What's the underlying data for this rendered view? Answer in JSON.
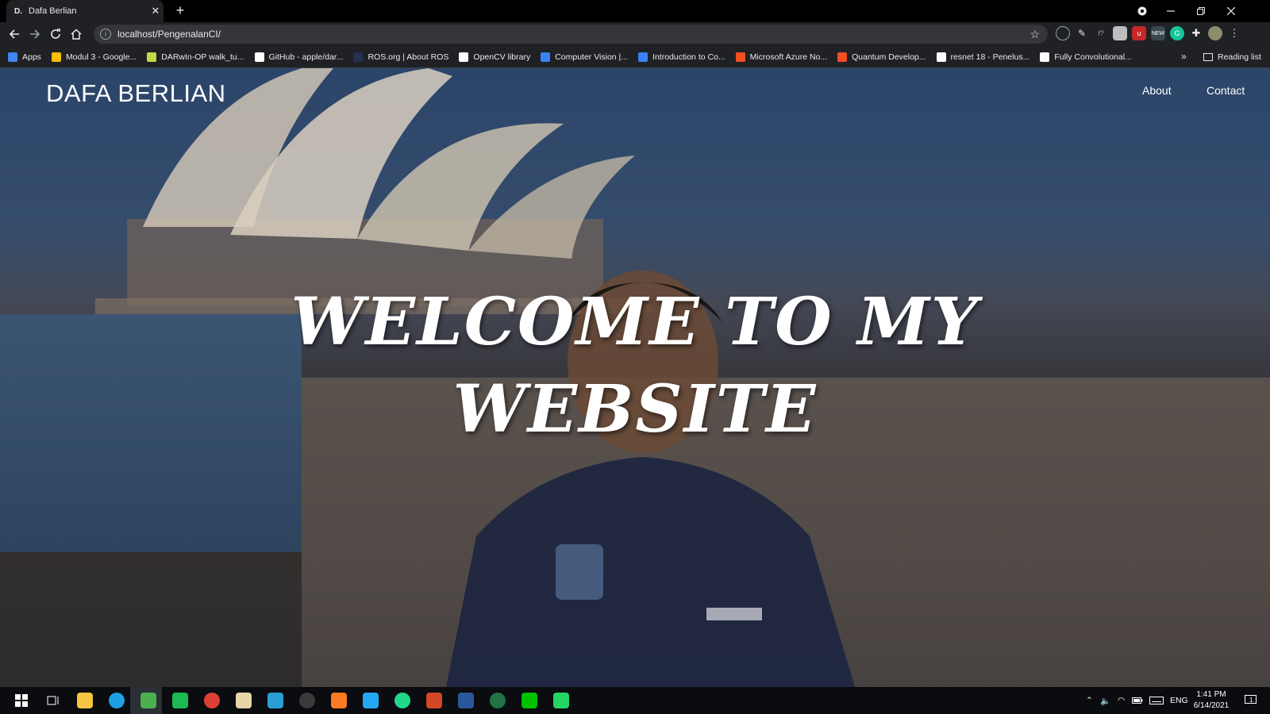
{
  "browser": {
    "tab": {
      "favicon": "D.",
      "title": "Dafa Berlian",
      "close_glyph": "✕"
    },
    "new_tab_glyph": "+",
    "url": "localhost/PengenalanCI/",
    "window_controls": [
      "minimize-icon",
      "restore-icon",
      "close-icon"
    ],
    "extensions": [
      "extension-icon",
      "extension-icon",
      "extension-icon",
      "extension-icon",
      "extension-icon",
      "extension-icon",
      "extension-icon",
      "puzzle-icon",
      "profile-avatar"
    ],
    "bookmarks": [
      {
        "label": "Apps",
        "icon": "apps-grid-icon",
        "color": "#4285f4"
      },
      {
        "label": "Modul 3 - Google...",
        "icon": "google-drive-icon",
        "color": "#fbbc04"
      },
      {
        "label": "DARwIn-OP walk_tu...",
        "icon": "bookmark-icon",
        "color": "#c6d64a"
      },
      {
        "label": "GitHub - apple/dar...",
        "icon": "github-icon",
        "color": "#ffffff"
      },
      {
        "label": "ROS.org | About ROS",
        "icon": "ros-icon",
        "color": "#22314e"
      },
      {
        "label": "OpenCV library",
        "icon": "opencv-icon",
        "color": "#ffffff"
      },
      {
        "label": "Computer Vision |...",
        "icon": "bookmark-icon",
        "color": "#3b82f6"
      },
      {
        "label": "Introduction to Co...",
        "icon": "bookmark-icon",
        "color": "#3b82f6"
      },
      {
        "label": "Microsoft Azure No...",
        "icon": "microsoft-icon",
        "color": "#f25022"
      },
      {
        "label": "Quantum Develop...",
        "icon": "microsoft-icon",
        "color": "#f25022"
      },
      {
        "label": "resnet 18 - Penelus...",
        "icon": "google-icon",
        "color": "#ffffff"
      },
      {
        "label": "Fully Convolutional...",
        "icon": "google-icon",
        "color": "#ffffff"
      }
    ],
    "bookmarks_overflow": "»",
    "reading_list": "Reading list"
  },
  "site": {
    "brand": "DAFA BERLIAN",
    "nav": {
      "about": "About",
      "contact": "Contact"
    },
    "hero_line1": "Welcome To My",
    "hero_line2": "Website"
  },
  "taskbar": {
    "apps": [
      {
        "name": "windows-start-icon",
        "color": "#ffffff"
      },
      {
        "name": "task-view-icon",
        "color": "#ffffff"
      },
      {
        "name": "file-explorer-icon",
        "color": "#f4c542"
      },
      {
        "name": "edge-icon",
        "color": "#1fa0e3"
      },
      {
        "name": "chrome-icon",
        "color": "#4caf50"
      },
      {
        "name": "spotify-icon",
        "color": "#1db954"
      },
      {
        "name": "todoist-icon",
        "color": "#db4035"
      },
      {
        "name": "dts-app-icon",
        "color": "#e8d6a8"
      },
      {
        "name": "window-app-icon",
        "color": "#2a9fd6"
      },
      {
        "name": "terminal-icon",
        "color": "#3a3a3a"
      },
      {
        "name": "xampp-icon",
        "color": "#fb7a24"
      },
      {
        "name": "vscode-icon",
        "color": "#23a9f2"
      },
      {
        "name": "pycharm-icon",
        "color": "#21d789"
      },
      {
        "name": "powerpoint-icon",
        "color": "#d24726"
      },
      {
        "name": "word-icon",
        "color": "#2b579a"
      },
      {
        "name": "excel-icon",
        "color": "#217346"
      },
      {
        "name": "line-icon",
        "color": "#00c300"
      },
      {
        "name": "whatsapp-icon",
        "color": "#25d366"
      }
    ],
    "language": "ENG",
    "time": "1:41 PM",
    "date": "6/14/2021",
    "notification_count": "1"
  }
}
